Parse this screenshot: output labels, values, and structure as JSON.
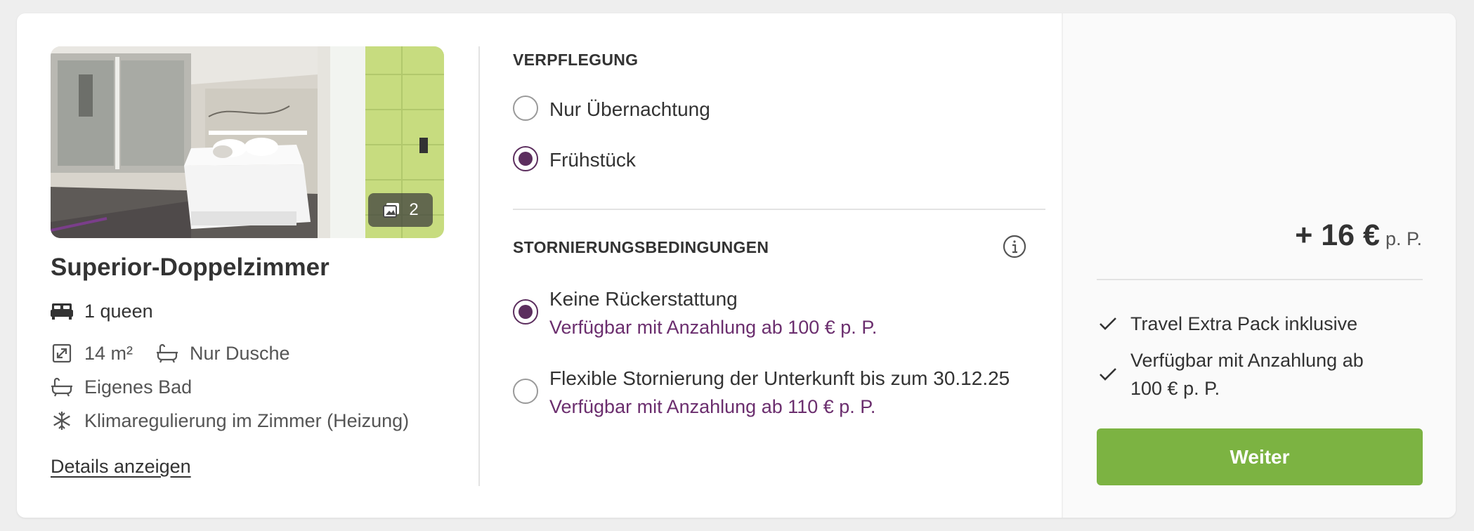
{
  "room": {
    "title": "Superior-Doppelzimmer",
    "photo_count": "2",
    "bed": "1 queen",
    "size": "14 m²",
    "shower": "Nur Dusche",
    "bathroom": "Eigenes Bad",
    "climate": "Klimaregulierung im Zimmer (Heizung)",
    "details_link": "Details anzeigen"
  },
  "icons": {
    "photo": "image-stack-icon",
    "bed": "bed-icon",
    "size": "resize-arrows-icon",
    "shower": "bathtub-icon",
    "bathroom": "bathtub-icon",
    "climate": "snowflake-icon",
    "info": "info-icon",
    "check": "checkmark-icon"
  },
  "meals": {
    "title": "VERPFLEGUNG",
    "options": [
      {
        "label": "Nur Übernachtung",
        "selected": false
      },
      {
        "label": "Frühstück",
        "selected": true
      }
    ]
  },
  "cancellation": {
    "title": "STORNIERUNGSBEDINGUNGEN",
    "options": [
      {
        "label": "Keine Rückerstattung",
        "sub": "Verfügbar mit Anzahlung ab 100 € p. P.",
        "selected": true
      },
      {
        "label": "Flexible Stornierung der Unterkunft bis zum 30.12.25",
        "sub": "Verfügbar mit Anzahlung ab 110 € p. P.",
        "selected": false
      }
    ]
  },
  "summary": {
    "price": "+ 16 €",
    "price_unit": "p. P.",
    "benefits": [
      "Travel Extra Pack inklusive",
      "Verfügbar mit Anzahlung ab 100 € p. P."
    ],
    "cta": "Weiter"
  },
  "colors": {
    "accent_purple": "#5c2e5e",
    "link_purple": "#6b2e6e",
    "cta_green": "#7cb342"
  }
}
